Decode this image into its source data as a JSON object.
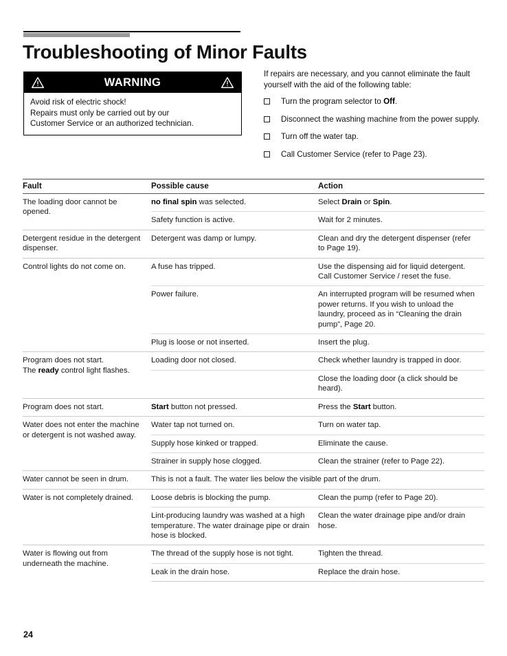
{
  "header": {
    "title": "Troubleshooting of Minor Faults"
  },
  "warning": {
    "title": "WARNING",
    "icon_left": "warning-triangle-icon",
    "icon_right": "warning-triangle-icon",
    "lines": [
      "Avoid risk of electric shock!",
      "Repairs must only be carried out by our",
      "Customer Service or an authorized technician."
    ]
  },
  "intro": {
    "text": "If repairs are necessary, and you cannot eliminate the fault yourself with the aid of the following table:",
    "bullets": [
      {
        "prefix": "Turn the program selector to ",
        "bold": "Off",
        "suffix": "."
      },
      {
        "prefix": "Disconnect the washing machine from the power supply.",
        "bold": "",
        "suffix": ""
      },
      {
        "prefix": "Turn off the water tap.",
        "bold": "",
        "suffix": ""
      },
      {
        "prefix": "Call Customer Service (refer to Page 23).",
        "bold": "",
        "suffix": ""
      }
    ]
  },
  "table": {
    "headers": [
      "Fault",
      "Possible cause",
      "Action"
    ],
    "rows": [
      {
        "fault": "The loading door cannot be opened.",
        "subrows": [
          {
            "cause_prefix": "",
            "cause_bold": "no final spin",
            "cause_suffix": " was selected.",
            "action_prefix": "Select ",
            "action_bold": "Drain",
            "action_mid": " or ",
            "action_bold2": "Spin",
            "action_suffix": "."
          },
          {
            "cause_prefix": "Safety function is active.",
            "cause_bold": "",
            "cause_suffix": "",
            "action_prefix": "Wait for 2 minutes.",
            "action_bold": "",
            "action_mid": "",
            "action_bold2": "",
            "action_suffix": ""
          }
        ]
      },
      {
        "fault": "Detergent residue in the detergent dispenser.",
        "subrows": [
          {
            "cause_prefix": "Detergent was damp or lumpy.",
            "cause_bold": "",
            "cause_suffix": "",
            "action_prefix": "Clean and dry the detergent dispenser (refer to Page 19).",
            "action_bold": "",
            "action_mid": "",
            "action_bold2": "",
            "action_suffix": ""
          }
        ]
      },
      {
        "fault": "Control lights do not come on.",
        "subrows": [
          {
            "cause_prefix": "A fuse has tripped.",
            "cause_bold": "",
            "cause_suffix": "",
            "action_prefix": "Use the dispensing aid for liquid detergent. Call Customer Service / reset the fuse.",
            "action_bold": "",
            "action_mid": "",
            "action_bold2": "",
            "action_suffix": ""
          },
          {
            "cause_prefix": "Power failure.",
            "cause_bold": "",
            "cause_suffix": "",
            "action_prefix": "An interrupted program will be resumed when power returns. If you wish to unload the laundry, proceed as in “Cleaning the drain pump”, Page 20.",
            "action_bold": "",
            "action_mid": "",
            "action_bold2": "",
            "action_suffix": ""
          },
          {
            "cause_prefix": "Plug is loose or not inserted.",
            "cause_bold": "",
            "cause_suffix": "",
            "action_prefix": "Insert the plug.",
            "action_bold": "",
            "action_mid": "",
            "action_bold2": "",
            "action_suffix": ""
          }
        ]
      },
      {
        "fault_prefix": "Program does not start.",
        "fault_line2_prefix": "The ",
        "fault_line2_bold": "ready",
        "fault_line2_suffix": " control light flashes.",
        "subrows": [
          {
            "cause_prefix": "Loading door not closed.",
            "cause_bold": "",
            "cause_suffix": "",
            "action_prefix": "Check whether laundry is trapped in door.",
            "action_bold": "",
            "action_mid": "",
            "action_bold2": "",
            "action_suffix": ""
          },
          {
            "cause_prefix": "",
            "cause_bold": "",
            "cause_suffix": "",
            "action_prefix": "Close the loading door (a click should be heard).",
            "action_bold": "",
            "action_mid": "",
            "action_bold2": "",
            "action_suffix": ""
          }
        ]
      },
      {
        "fault": "Program does not start.",
        "subrows": [
          {
            "cause_prefix": "",
            "cause_bold": "Start",
            "cause_suffix": " button not pressed.",
            "action_prefix": "Press the ",
            "action_bold": "Start",
            "action_mid": "",
            "action_bold2": "",
            "action_suffix": " button."
          }
        ]
      },
      {
        "fault": "Water does not enter the machine or detergent is not washed away.",
        "subrows": [
          {
            "cause_prefix": "Water tap not turned on.",
            "cause_bold": "",
            "cause_suffix": "",
            "action_prefix": "Turn on water tap.",
            "action_bold": "",
            "action_mid": "",
            "action_bold2": "",
            "action_suffix": ""
          },
          {
            "cause_prefix": "Supply hose kinked or trapped.",
            "cause_bold": "",
            "cause_suffix": "",
            "action_prefix": "Eliminate the cause.",
            "action_bold": "",
            "action_mid": "",
            "action_bold2": "",
            "action_suffix": ""
          },
          {
            "cause_prefix": "Strainer in supply hose clogged.",
            "cause_bold": "",
            "cause_suffix": "",
            "action_prefix": "Clean the strainer (refer to Page 22).",
            "action_bold": "",
            "action_mid": "",
            "action_bold2": "",
            "action_suffix": ""
          }
        ]
      },
      {
        "fault": "Water cannot be seen in drum.",
        "span_cause": "This is not a fault. The water lies below the visible part of the drum."
      },
      {
        "fault": "Water is not completely drained.",
        "subrows": [
          {
            "cause_prefix": "Loose debris is blocking the pump.",
            "cause_bold": "",
            "cause_suffix": "",
            "action_prefix": "Clean the pump (refer to Page 20).",
            "action_bold": "",
            "action_mid": "",
            "action_bold2": "",
            "action_suffix": ""
          },
          {
            "cause_prefix": "Lint-producing laundry was washed at a high temperature. The water drainage pipe or drain hose is blocked.",
            "cause_bold": "",
            "cause_suffix": "",
            "action_prefix": "Clean the water drainage pipe and/or drain hose.",
            "action_bold": "",
            "action_mid": "",
            "action_bold2": "",
            "action_suffix": ""
          }
        ]
      },
      {
        "fault": "Water is flowing out from underneath the machine.",
        "subrows": [
          {
            "cause_prefix": "The thread of the supply hose is not tight.",
            "cause_bold": "",
            "cause_suffix": "",
            "action_prefix": "Tighten the thread.",
            "action_bold": "",
            "action_mid": "",
            "action_bold2": "",
            "action_suffix": ""
          },
          {
            "cause_prefix": "Leak in the drain hose.",
            "cause_bold": "",
            "cause_suffix": "",
            "action_prefix": "Replace the drain hose.",
            "action_bold": "",
            "action_mid": "",
            "action_bold2": "",
            "action_suffix": ""
          }
        ]
      }
    ]
  },
  "footer": {
    "page_number": "24"
  }
}
